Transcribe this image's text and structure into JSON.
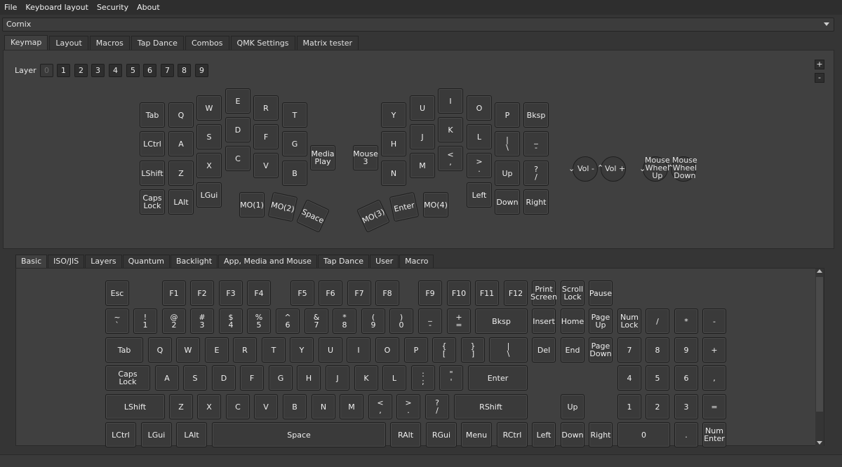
{
  "menu": [
    "File",
    "Keyboard layout",
    "Security",
    "About"
  ],
  "device": {
    "selected": "Cornix"
  },
  "tabs": [
    "Keymap",
    "Layout",
    "Macros",
    "Tap Dance",
    "Combos",
    "QMK Settings",
    "Matrix tester"
  ],
  "layers": {
    "label": "Layer",
    "items": [
      "0",
      "1",
      "2",
      "3",
      "4",
      "5",
      "6",
      "7",
      "8",
      "9"
    ]
  },
  "zoom": {
    "plus": "+",
    "minus": "-"
  },
  "keymap": {
    "left": {
      "tab": "Tab",
      "q": "Q",
      "w": "W",
      "e": "E",
      "r": "R",
      "t": "T",
      "lctrl": "LCtrl",
      "a": "A",
      "s": "S",
      "d": "D",
      "f": "F",
      "g": "G",
      "lshift": "LShift",
      "z": "Z",
      "x": "X",
      "c": "C",
      "v": "V",
      "b": "B",
      "caps": "Caps\nLock",
      "lalt": "LAlt",
      "lgui": "LGui",
      "media_play": "Media\nPlay",
      "mo1": "MO(1)",
      "mo2": "MO(2)",
      "space": "Space"
    },
    "right": {
      "mouse3": "Mouse\n3",
      "y": "Y",
      "u": "U",
      "i": "I",
      "o": "O",
      "p": "P",
      "bksp": "Bksp",
      "h": "H",
      "j": "J",
      "k": "K",
      "l": "L",
      "pipe": "|\n\\",
      "underscore": "_\n-",
      "n": "N",
      "m": "M",
      "lt": "<\n,",
      "gt": ">\n.",
      "up": "Up",
      "question": "?\n/",
      "left": "Left",
      "down": "Down",
      "right": "Right",
      "mo3": "MO(3)",
      "enter": "Enter",
      "mo4": "MO(4)"
    },
    "encoders": {
      "vol_down": "Vol -",
      "vol_up": "Vol +",
      "wheel_up": "Mouse\nWheel\nUp",
      "wheel_down": "Mouse\nWheel\nDown"
    }
  },
  "subtabs": [
    "Basic",
    "ISO/JIS",
    "Layers",
    "Quantum",
    "Backlight",
    "App, Media and Mouse",
    "Tap Dance",
    "User",
    "Macro"
  ],
  "basic_keys": {
    "row0": [
      "Esc",
      "F1",
      "F2",
      "F3",
      "F4",
      "F5",
      "F6",
      "F7",
      "F8",
      "F9",
      "F10",
      "F11",
      "F12",
      "Print\nScreen",
      "Scroll\nLock",
      "Pause"
    ],
    "row1": [
      "~\n`",
      "!\n1",
      "@\n2",
      "#\n3",
      "$\n4",
      "%\n5",
      "^\n6",
      "&\n7",
      "*\n8",
      "(\n9",
      ")\n0",
      "_\n-",
      "+\n=",
      "Bksp",
      "Insert",
      "Home",
      "Page\nUp",
      "Num\nLock",
      "/",
      "*",
      "-"
    ],
    "row2": [
      "Tab",
      "Q",
      "W",
      "E",
      "R",
      "T",
      "Y",
      "U",
      "I",
      "O",
      "P",
      "{\n[",
      "}\n]",
      "|\n\\",
      "Del",
      "End",
      "Page\nDown",
      "7",
      "8",
      "9",
      "+"
    ],
    "row3": [
      "Caps\nLock",
      "A",
      "S",
      "D",
      "F",
      "G",
      "H",
      "J",
      "K",
      "L",
      ":\n;",
      "\"\n'",
      "Enter",
      "4",
      "5",
      "6",
      ","
    ],
    "row4": [
      "LShift",
      "Z",
      "X",
      "C",
      "V",
      "B",
      "N",
      "M",
      "<\n,",
      ">\n.",
      "?\n/",
      "RShift",
      "Up",
      "1",
      "2",
      "3",
      "="
    ],
    "row5": [
      "LCtrl",
      "LGui",
      "LAlt",
      "Space",
      "RAlt",
      "RGui",
      "Menu",
      "RCtrl",
      "Left",
      "Down",
      "Right",
      "0",
      ".",
      "Num\nEnter"
    ]
  }
}
